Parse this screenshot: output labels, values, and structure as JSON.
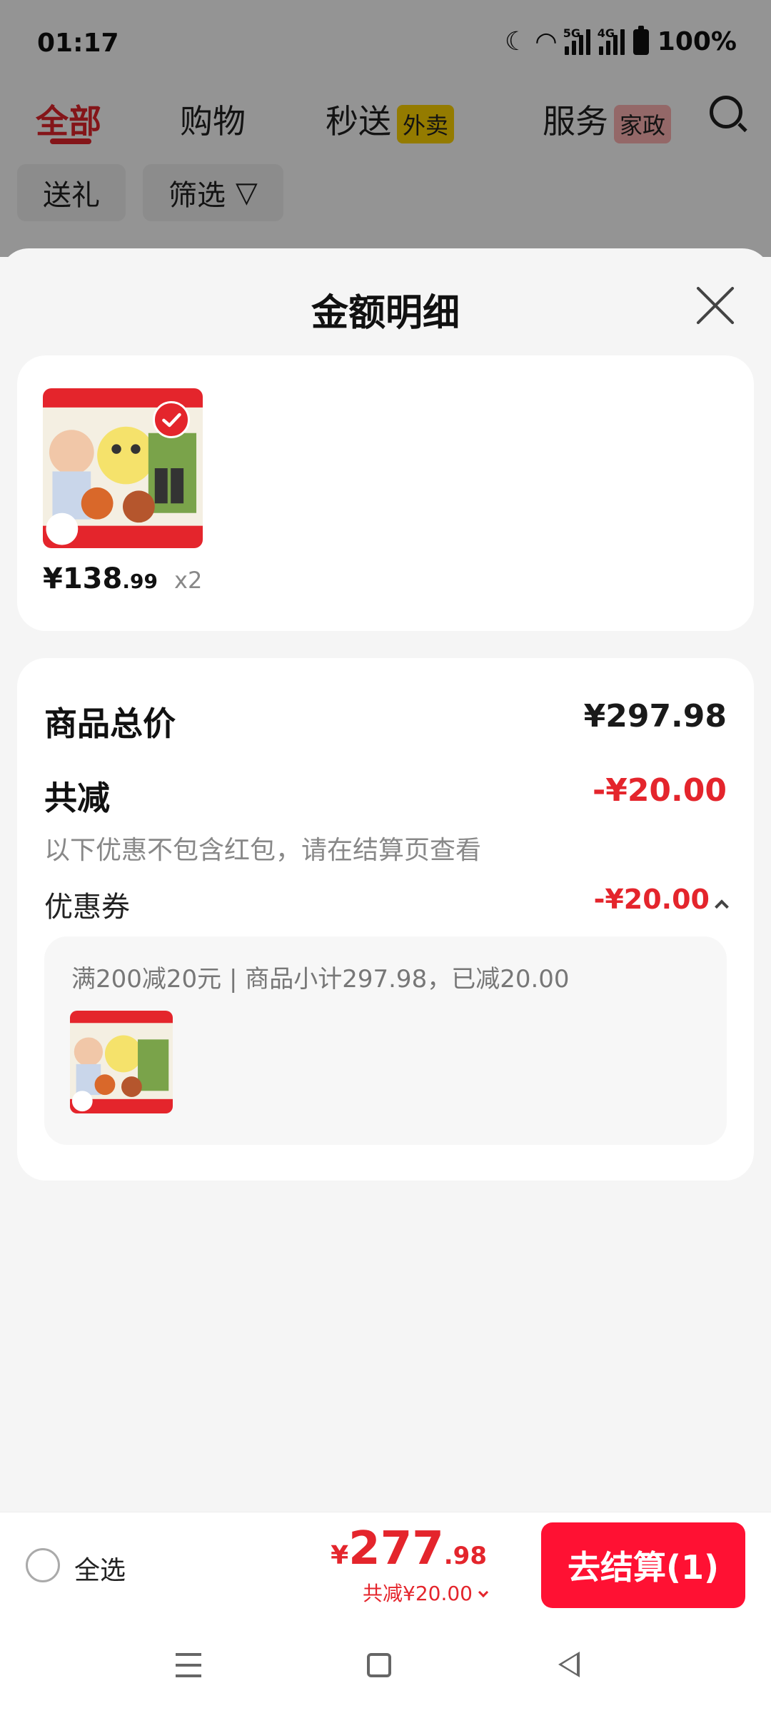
{
  "status_bar": {
    "time": "01:17",
    "net1": "5G",
    "net2": "4G",
    "battery": "100%"
  },
  "tabs": [
    {
      "label": "全部"
    },
    {
      "label": "购物"
    },
    {
      "label": "秒送",
      "badge": "外卖"
    },
    {
      "label": "服务",
      "badge": "家政"
    }
  ],
  "chips": [
    {
      "label": "送礼"
    },
    {
      "label": "筛选"
    }
  ],
  "sheet": {
    "title": "金额明细",
    "item": {
      "price_symbol": "¥",
      "price_int": "138",
      "price_dec": ".99",
      "quantity": "x2"
    },
    "summary": {
      "total_label": "商品总价",
      "total_value": "¥297.98",
      "discount_label": "共减",
      "discount_value": "-¥20.00",
      "discount_note": "以下优惠不包含红包，请在结算页查看",
      "coupon_label": "优惠券",
      "coupon_value": "-¥20.00",
      "coupon_detail": "满200减20元 | 商品小计297.98，已减20.00"
    }
  },
  "bottom": {
    "select_all": "全选",
    "total_symbol": "¥",
    "total_int": "277",
    "total_dec": ".98",
    "reduced": "共减¥20.00",
    "checkout": "去结算(1)"
  },
  "colors": {
    "accent": "#e4252c",
    "checkout_bg": "#ff1133"
  },
  "icons": [
    "search-icon",
    "filter-icon",
    "close-icon",
    "check-icon",
    "chevron-up-icon",
    "chevron-down-icon",
    "menu-icon",
    "home-icon",
    "back-icon"
  ]
}
